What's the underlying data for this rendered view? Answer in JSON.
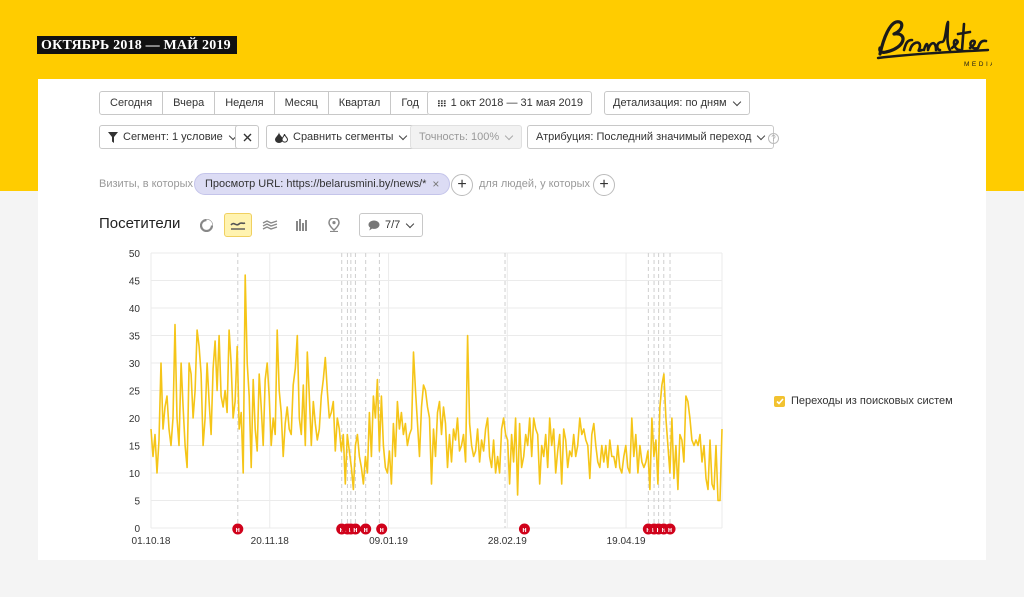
{
  "banner": {
    "title": "ОКТЯБРЬ 2018 — МАЙ 2019"
  },
  "logo": {
    "name": "Brandster",
    "sub": "MEDIA"
  },
  "toolbar": {
    "periods": [
      "Сегодня",
      "Вчера",
      "Неделя",
      "Месяц",
      "Квартал",
      "Год"
    ],
    "date_range": "1 окт 2018 — 31 мая 2019",
    "detail": "Детализация: по дням"
  },
  "filters": {
    "segment": "Сегмент: 1 условие",
    "compare": "Сравнить сегменты",
    "accuracy": "Точность: 100%",
    "attribution": "Атрибуция: Последний значимый переход",
    "help": "?"
  },
  "conditions": {
    "visits_label": "Визиты, в которых",
    "url_condition": "Просмотр URL: https://belarusmini.by/news/*",
    "people_label": "для людей, у которых"
  },
  "chart_header": {
    "title": "Посетители",
    "series_count": "7/7"
  },
  "chart_data": {
    "type": "line",
    "color": "#f5c518",
    "x_tick_labels": [
      "01.10.18",
      "20.11.18",
      "09.01.19",
      "28.02.19",
      "19.04.19"
    ],
    "ylim": [
      0,
      50
    ],
    "y_ticks": [
      0,
      5,
      10,
      15,
      20,
      25,
      30,
      35,
      40,
      45,
      50
    ],
    "grid": true,
    "legend_position": "right",
    "series": [
      {
        "name": "Переходы из поисковых систем",
        "values": [
          18,
          13,
          17,
          10,
          16,
          30,
          18,
          22,
          24,
          18,
          15,
          20,
          37,
          20,
          15,
          30,
          22,
          15,
          11,
          30,
          28,
          20,
          25,
          36,
          33,
          28,
          15,
          20,
          30,
          23,
          17,
          29,
          34,
          25,
          35,
          24,
          22,
          25,
          21,
          36,
          30,
          20,
          23,
          33,
          18,
          21,
          10,
          46,
          30,
          24,
          11,
          27,
          18,
          14,
          28,
          22,
          15,
          27,
          30,
          24,
          15,
          20,
          17,
          36,
          25,
          21,
          13,
          19,
          22,
          18,
          17,
          26,
          29,
          35,
          20,
          17,
          26,
          15,
          32,
          24,
          15,
          23,
          19,
          16,
          18,
          24,
          27,
          31,
          25,
          20,
          21,
          23,
          14,
          20,
          18,
          14,
          17,
          8,
          17,
          14,
          11,
          7,
          15,
          17,
          13,
          11,
          8,
          13,
          10,
          21,
          13,
          24,
          20,
          27,
          14,
          24,
          15,
          11,
          10,
          14,
          8,
          19,
          13,
          23,
          18,
          21,
          17,
          19,
          15,
          17,
          18,
          32,
          25,
          19,
          13,
          22,
          26,
          25,
          22,
          20,
          8,
          18,
          13,
          21,
          23,
          17,
          22,
          19,
          11,
          17,
          12,
          18,
          16,
          20,
          14,
          15,
          17,
          12,
          35,
          19,
          15,
          13,
          14,
          18,
          12,
          16,
          14,
          18,
          20,
          13,
          11,
          16,
          10,
          13,
          10,
          18,
          20,
          17,
          16,
          8,
          17,
          12,
          20,
          6,
          19,
          11,
          13,
          17,
          15,
          20,
          13,
          20,
          18,
          17,
          8,
          15,
          13,
          17,
          11,
          20,
          15,
          18,
          10,
          14,
          17,
          8,
          18,
          16,
          11,
          14,
          13,
          17,
          13,
          15,
          20,
          17,
          18,
          16,
          15,
          9,
          17,
          19,
          15,
          12,
          11,
          15,
          12,
          15,
          11,
          16,
          13,
          13,
          11,
          15,
          11,
          10,
          13,
          15,
          11,
          10,
          20,
          13,
          17,
          10,
          15,
          12,
          11,
          12,
          14,
          7,
          20,
          13,
          16,
          8,
          22,
          26,
          28,
          20,
          15,
          10,
          20,
          9,
          15,
          7,
          17,
          16,
          12,
          24,
          23,
          20,
          16,
          15,
          16,
          15,
          17,
          12,
          15,
          9,
          7,
          16,
          8,
          7,
          15,
          5,
          5,
          18
        ]
      }
    ],
    "event_markers": {
      "label": "н",
      "positions": [
        0.152,
        0.334,
        0.344,
        0.35,
        0.358,
        0.376,
        0.404,
        0.654,
        0.871,
        0.881,
        0.889,
        0.898,
        0.909
      ]
    },
    "event_dashed_lines": [
      0.152,
      0.334,
      0.344,
      0.35,
      0.358,
      0.376,
      0.4,
      0.62,
      0.871,
      0.881,
      0.889,
      0.898,
      0.909
    ]
  }
}
